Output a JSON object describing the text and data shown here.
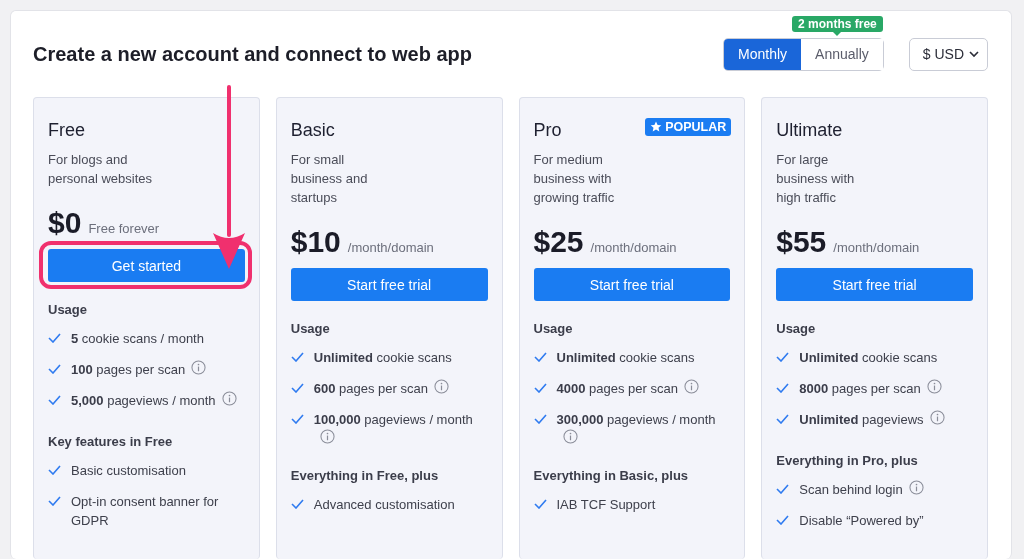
{
  "title": "Create a new account and connect to web app",
  "billing": {
    "badge": "2 months free",
    "options": [
      {
        "label": "Monthly",
        "selected": true
      },
      {
        "label": "Annually",
        "selected": false
      }
    ]
  },
  "currency": {
    "value": "$ USD"
  },
  "plans": [
    {
      "name": "Free",
      "description": "For blogs and\npersonal websites",
      "price": "$0",
      "price_note": "Free forever",
      "button": "Get started",
      "sections": [
        {
          "heading": "Usage",
          "features": [
            {
              "text": "**5** cookie scans / month",
              "info": false
            },
            {
              "text": "**100** pages per scan",
              "info": true
            },
            {
              "text": "**5,000** pageviews / month",
              "info": true
            }
          ]
        },
        {
          "heading": "Key features in Free",
          "features": [
            {
              "text": "Basic customisation",
              "info": false
            },
            {
              "text": "Opt-in consent banner for GDPR",
              "info": false
            }
          ]
        }
      ]
    },
    {
      "name": "Basic",
      "description": "For small\nbusiness and\nstartups",
      "price": "$10",
      "price_note": "/month/domain",
      "button": "Start free trial",
      "sections": [
        {
          "heading": "Usage",
          "features": [
            {
              "text": "**Unlimited** cookie scans",
              "info": false
            },
            {
              "text": "**600** pages per scan",
              "info": true
            },
            {
              "text": "**100,000** pageviews / month",
              "info": true
            }
          ]
        },
        {
          "heading": "Everything in Free, plus",
          "features": [
            {
              "text": "Advanced customisation",
              "info": false
            }
          ]
        }
      ]
    },
    {
      "name": "Pro",
      "badge": "POPULAR",
      "description": "For medium\nbusiness with\ngrowing traffic",
      "price": "$25",
      "price_note": "/month/domain",
      "button": "Start free trial",
      "sections": [
        {
          "heading": "Usage",
          "features": [
            {
              "text": "**Unlimited** cookie scans",
              "info": false
            },
            {
              "text": "**4000** pages per scan",
              "info": true
            },
            {
              "text": "**300,000** pageviews / month",
              "info": true
            }
          ]
        },
        {
          "heading": "Everything in Basic, plus",
          "features": [
            {
              "text": "IAB TCF Support",
              "info": false
            }
          ]
        }
      ]
    },
    {
      "name": "Ultimate",
      "description": "For large\nbusiness with\nhigh traffic",
      "price": "$55",
      "price_note": "/month/domain",
      "button": "Start free trial",
      "sections": [
        {
          "heading": "Usage",
          "features": [
            {
              "text": "**Unlimited** cookie scans",
              "info": false
            },
            {
              "text": "**8000** pages per scan",
              "info": true
            },
            {
              "text": "**Unlimited** pageviews",
              "info": true
            }
          ]
        },
        {
          "heading": "Everything in Pro, plus",
          "features": [
            {
              "text": "Scan behind login",
              "info": true
            },
            {
              "text": "Disable “Powered by”",
              "info": false
            }
          ]
        }
      ]
    }
  ]
}
